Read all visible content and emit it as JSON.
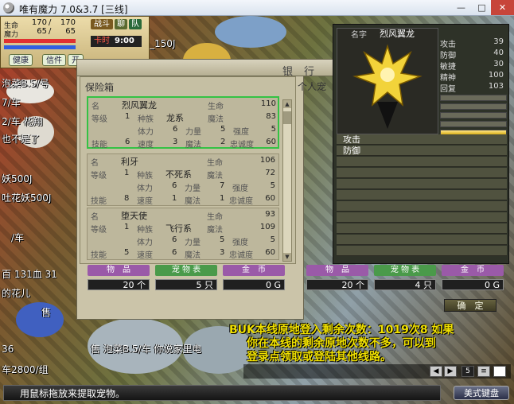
{
  "window": {
    "title": "唯有魔力 7.0&3.7 [三线]",
    "min": "—",
    "max": "□",
    "close": "✕"
  },
  "hud": {
    "hp_label": "生命",
    "hp": "170",
    "hp_max": "170",
    "hp_sep": "/",
    "mp_label": "魔力",
    "mp": "65",
    "mp_max": "65",
    "btn_battle": "战斗",
    "btn_chat": "聊",
    "btn_team": "队",
    "card_label": "卡时",
    "card_time": "9:00",
    "tabs": [
      "健康",
      "信件",
      "开"
    ],
    "hp_ratio": 1.0,
    "mp_ratio": 1.0
  },
  "scene": {
    "chat": [
      "泡菜B.5/号",
      "7/车",
      "2/车  花翔",
      "也不是了",
      "妖500J",
      "吐花妖500J",
      "/车",
      "百 131血 31",
      "的花儿",
      "售 泡菜B.5/车  你说家里电",
      "36",
      "车2800/组",
      "_150J",
      "售"
    ]
  },
  "bank": {
    "title": "银行",
    "box_title": "保险箱",
    "personal_title": "个人宠",
    "pets": [
      {
        "name_label": "名",
        "name": "烈风翼龙",
        "hp_label": "生命",
        "hp": "110",
        "lv_label": "等级",
        "lv": "1",
        "race_label": "种族",
        "race": "龙系",
        "mp_label": "魔法",
        "mp": "83",
        "vit_label": "体力",
        "vit": "6",
        "str_label": "力量",
        "str": "5",
        "tou_label": "强度",
        "tou": "5",
        "sk_label": "技能",
        "sk": "6",
        "spd_label": "速度",
        "spd": "3",
        "mag_label": "魔法",
        "mag": "2",
        "loy_label": "忠诚度",
        "loy": "60"
      },
      {
        "name_label": "名",
        "name": "利牙",
        "hp_label": "生命",
        "hp": "106",
        "lv_label": "等级",
        "lv": "1",
        "race_label": "种族",
        "race": "不死系",
        "mp_label": "魔法",
        "mp": "72",
        "vit_label": "体力",
        "vit": "6",
        "str_label": "力量",
        "str": "7",
        "tou_label": "强度",
        "tou": "5",
        "sk_label": "技能",
        "sk": "8",
        "spd_label": "速度",
        "spd": "1",
        "mag_label": "魔法",
        "mag": "1",
        "loy_label": "忠诚度",
        "loy": "60"
      },
      {
        "name_label": "名",
        "name": "堕天使",
        "hp_label": "生命",
        "hp": "93",
        "lv_label": "等级",
        "lv": "1",
        "race_label": "种族",
        "race": "飞行系",
        "mp_label": "魔法",
        "mp": "109",
        "vit_label": "体力",
        "vit": "6",
        "str_label": "力量",
        "str": "5",
        "tou_label": "强度",
        "tou": "5",
        "sk_label": "技能",
        "sk": "5",
        "spd_label": "速度",
        "spd": "6",
        "mag_label": "魔法",
        "mag": "3",
        "loy_label": "忠诚度",
        "loy": "60"
      }
    ],
    "box_footer": {
      "item_btn": "物　品",
      "pet_btn": "宠 物 表",
      "gold_btn": "金　币",
      "items": "20 个",
      "pets": "5 只",
      "gold": "0 G"
    },
    "personal_footer": {
      "item_btn": "物　品",
      "pet_btn": "宠 物 表",
      "gold_btn": "金　币",
      "items": "20 个",
      "pets": "4 只",
      "gold": "0 G"
    },
    "confirm": "确　定"
  },
  "detail": {
    "name_label": "名字",
    "name": "烈风翼龙",
    "stats": [
      {
        "k": "攻击",
        "v": "39"
      },
      {
        "k": "防御",
        "v": "40"
      },
      {
        "k": "敏捷",
        "v": "30"
      },
      {
        "k": "精神",
        "v": "100"
      },
      {
        "k": "回复",
        "v": "103"
      }
    ],
    "gauges": [
      0.0,
      0.0,
      0.0,
      0.0,
      0.35,
      1.0
    ],
    "skills": [
      "",
      "攻击",
      "防御",
      "",
      "",
      "",
      "",
      "",
      "",
      "",
      ""
    ]
  },
  "system_message": [
    "BUK本线原地登入剩余次数：1019次8 如果",
    "你在本线的剩余原地次数不多，可以到",
    "登录点领取或登陆其他线路。"
  ],
  "chatbar": {
    "channel": "5",
    "prev": "◀",
    "next": "▶",
    "menu": "≡"
  },
  "status_text": "用鼠标拖放来提取宠物。",
  "ime_label": "美式键盘",
  "colors": {
    "selected_border": "#34c244",
    "system_text": "#f0e000",
    "close_button": "#c7453a"
  }
}
